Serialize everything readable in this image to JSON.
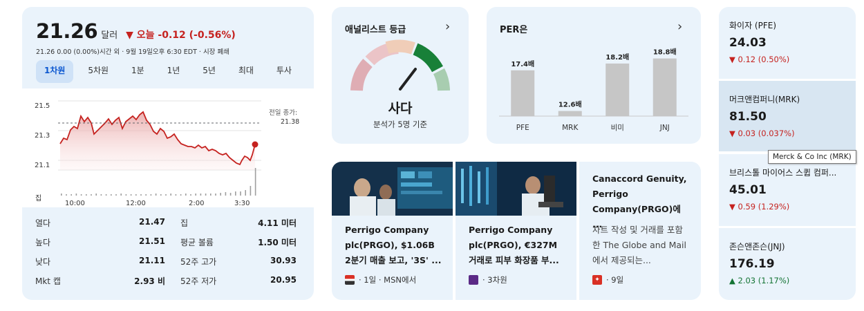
{
  "stock": {
    "price": "21.26",
    "unit": "달러",
    "change": "▼ 오늘 -0.12 (-0.56%)",
    "subline": "21.26  0.00 (0.00%)시간 외 · 9월 19일오후 6:30 EDT · 시장 폐쇄",
    "tabs": [
      "1차원",
      "5차원",
      "1분",
      "1년",
      "5년",
      "최대",
      "투사"
    ],
    "active_tab": "1차원",
    "chart": {
      "y_ticks": [
        "21.5",
        "21.3",
        "21.1"
      ],
      "x_ticks": [
        "10:00",
        "12:00",
        "2:00",
        "3:30"
      ],
      "volume_label": "집",
      "prev_close_label": "전일 종가:",
      "prev_close_value": "21.38"
    },
    "stats": [
      {
        "l1": "열다",
        "v1": "21.47",
        "l2": "집",
        "v2": "4.11 미터"
      },
      {
        "l1": "높다",
        "v1": "21.51",
        "l2": "평균 볼륨",
        "v2": "1.50 미터"
      },
      {
        "l1": "낮다",
        "v1": "21.11",
        "l2": "52주 고가",
        "v2": "30.93"
      },
      {
        "l1": "Mkt 캡",
        "v1": "2.93 비",
        "l2": "52주 저가",
        "v2": "20.95"
      }
    ]
  },
  "analyst": {
    "title": "애널리스트 등급",
    "rating": "사다",
    "subtitle": "분석가 5명 기준",
    "gauge_level": "buy"
  },
  "per": {
    "title": "PER은",
    "chart_data": {
      "type": "bar",
      "categories": [
        "PFE",
        "MRK",
        "비미",
        "JNJ"
      ],
      "values": [
        17.4,
        12.6,
        18.2,
        18.8
      ],
      "labels": [
        "17.4배",
        "12.6배",
        "18.2배",
        "18.8배"
      ],
      "ylim": [
        12,
        19.5
      ]
    }
  },
  "news": [
    {
      "title": "Perrigo Company plc(PRGO), $1.06B 2분기 매출 보고, '3S' ...",
      "meta": "· 1일 · MSN에서"
    },
    {
      "title": "Perrigo Company plc(PRGO), €327M 거래로 피부 화장품 부...",
      "meta": "· 3차원"
    },
    {
      "title": "Canaccord Genuity, Perrigo Company(PRGO)에 ...",
      "desc": "차트 작성 및 거래를 포함한 The Globe and Mail에서 제공되는...",
      "meta": "· 9일"
    }
  ],
  "tickers": [
    {
      "name": "화이자 (PFE)",
      "price": "24.03",
      "change": "▼ 0.12 (0.50%)",
      "dir": "down"
    },
    {
      "name": "머크앤컴퍼니(MRK)",
      "price": "81.50",
      "change": "▼ 0.03 (0.037%)",
      "dir": "down"
    },
    {
      "name": "브리스톨 마이어스 스큅 컴퍼...",
      "price": "45.01",
      "change": "▼ 0.59 (1.29%)",
      "dir": "down"
    },
    {
      "name": "존슨앤존슨(JNJ)",
      "price": "176.19",
      "change": "▲ 2.03 (1.17%)",
      "dir": "up"
    }
  ],
  "tooltip": "Merck & Co Inc (MRK)",
  "colors": {
    "down": "#c5221f",
    "up": "#137333",
    "accent": "#0b57d0",
    "gauge_active": "#188038"
  }
}
